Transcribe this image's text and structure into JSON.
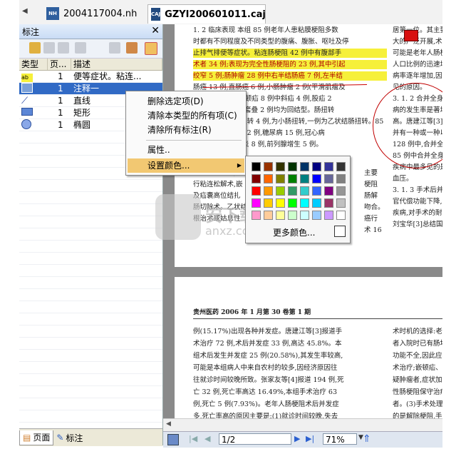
{
  "tabs": [
    {
      "label": "2004117004.nh",
      "icon": "NH"
    },
    {
      "label": "GZYI200601011.caj",
      "icon": "CAJ"
    }
  ],
  "annotation_panel": {
    "title": "标注",
    "columns": [
      "类型",
      "页...",
      "描述"
    ],
    "rows": [
      {
        "type_icon": "highlight-text-icon",
        "page": "1",
        "desc": "便等症状。粘连..."
      },
      {
        "type_icon": "annotation-note-icon",
        "page": "1",
        "desc": "注释一"
      },
      {
        "type_icon": "line-icon",
        "page": "1",
        "desc": "直线"
      },
      {
        "type_icon": "rectangle-icon",
        "page": "1",
        "desc": "矩形"
      },
      {
        "type_icon": "ellipse-icon",
        "page": "1",
        "desc": "椭圆"
      }
    ],
    "bottom_tabs": [
      "页面",
      "标注"
    ]
  },
  "context_menu": {
    "items": [
      "删除选定项(D)",
      "清除本类型的所有项(C)",
      "清除所有标注(R)",
      "属性..",
      "设置颜色..."
    ]
  },
  "color_palette": {
    "colors": [
      [
        "#000000",
        "#993300",
        "#333300",
        "#003300",
        "#003366",
        "#000080",
        "#333399",
        "#333333"
      ],
      [
        "#800000",
        "#ff6600",
        "#808000",
        "#008000",
        "#008080",
        "#0000ff",
        "#666699",
        "#808080"
      ],
      [
        "#ff0000",
        "#ff9900",
        "#99cc00",
        "#339966",
        "#33cccc",
        "#3366ff",
        "#800080",
        "#969696"
      ],
      [
        "#ff00ff",
        "#ffcc00",
        "#ffff00",
        "#00ff00",
        "#00ffff",
        "#00ccff",
        "#993366",
        "#c0c0c0"
      ],
      [
        "#ff99cc",
        "#ffcc99",
        "#ffff99",
        "#ccffcc",
        "#ccffff",
        "#99ccff",
        "#cc99ff",
        "#ffffff"
      ]
    ],
    "more_label": "更多颜色..."
  },
  "document": {
    "page1_left": [
      "1. 2  临床表现  本组 85 例老年人患粘膜梗阻多数",
      "时都有不同程度及不同类型的腹痛、腹胀、呕吐及停",
      "止排气排便等症状。粘连肠梗阻 42 例中有腹部手",
      "术者 34 例;表现为完全性肠梗阻的 23 例,其中引起",
      "绞窄 5 例;肠肿瘤 28 例中右半结肠癌 7 例,左半结",
      "肠癌 13 例,直肠癌 6 例,小肠肿瘤 2 例(平滑肌瘤及",
      "腺癌各 1 例)。嵌顿疝 8 例中斜疝 4 例,股疝 2",
      "例,脐疝 2 例。肠套叠 2 例均为回结型。肠扭转",
      "5 例中乙状结肠扭转 4 例,为小肠扭转,一例为乙状结肠扭转。85",
      "例中合并高血压 12 例,糖尿病 15 例,冠心病",
      "9 例,慢性支气管炎 8 例,前列腺增生 5 例。"
    ],
    "page1_left_lower": [
      "为粘连肠梗阻,主要",
      "行粘连松解术,嵌",
      "及疝囊高位结扎",
      "肠切除术。乙状结",
      "根治术或姑息性"
    ],
    "page1_left_lower_right": [
      "主要",
      "梗阻",
      "肠解",
      "吻合。",
      "癌行",
      "术 16"
    ],
    "page1_right": [
      "居第一位。其主要原因",
      "大的广泛开展,术后肠粘",
      "可能是老年人肠梗阻的",
      "人口比例的迅速增加,",
      "病率逐年增加,因此肠",
      "见的原因。",
      "3. 1. 2  合并全身疾病",
      "病的发生率是著增加",
      "高。唐建江等[3]报道",
      "并有一种或一种以",
      "128 例中,合并全身疾",
      "85 例中合并全身疾病",
      "疾病中最多见的是心",
      "血压。",
      "3. 1. 3  手术后并发症",
      "官代偿功能下降,免疫",
      "疾病,对手术的耐受力",
      "刘宝华[3]总结国内 9"
    ],
    "page2_header": "贵州医药 2006 年 1 月第 30 卷第 1 期",
    "page2_left": [
      "例(15.17%)出现各种并发症。唐建江等[3]报道手",
      "术治疗 72 例,术后并发症 33 例,高达 45.8%。本",
      "组术后发生并发症 25 例(20.58%),其发生率较高,",
      "可能是本组病人中来自农村的较多,因经济原因往",
      "往就诊时间较晚所致。张家友等[4]报道 194 例,死",
      "亡 32 例,死亡率高达 16.49%,本组手术治疗 63",
      "例,死亡 5 例(7.93%)。老年人肠梗阻术后并发症",
      "多,死亡率高的原因主要是:(1)就诊时间较晚,失去"
    ],
    "page2_right": [
      "术时机的选择:老年肠",
      "者入院时已有肠坏死,",
      "功能不全,因此应尽早",
      "术治疗;嵌顿疝、绞窄性",
      "疑肿瘤者,症状加重,",
      "性肠梗阻保守治疗 1",
      "者。(3)手术处理:老",
      "的是解除梗阻,手术力"
    ]
  },
  "statusbar": {
    "page": "1/2",
    "zoom": "71%"
  },
  "watermark": {
    "line1": "安下载",
    "line2": "anxz.com"
  }
}
